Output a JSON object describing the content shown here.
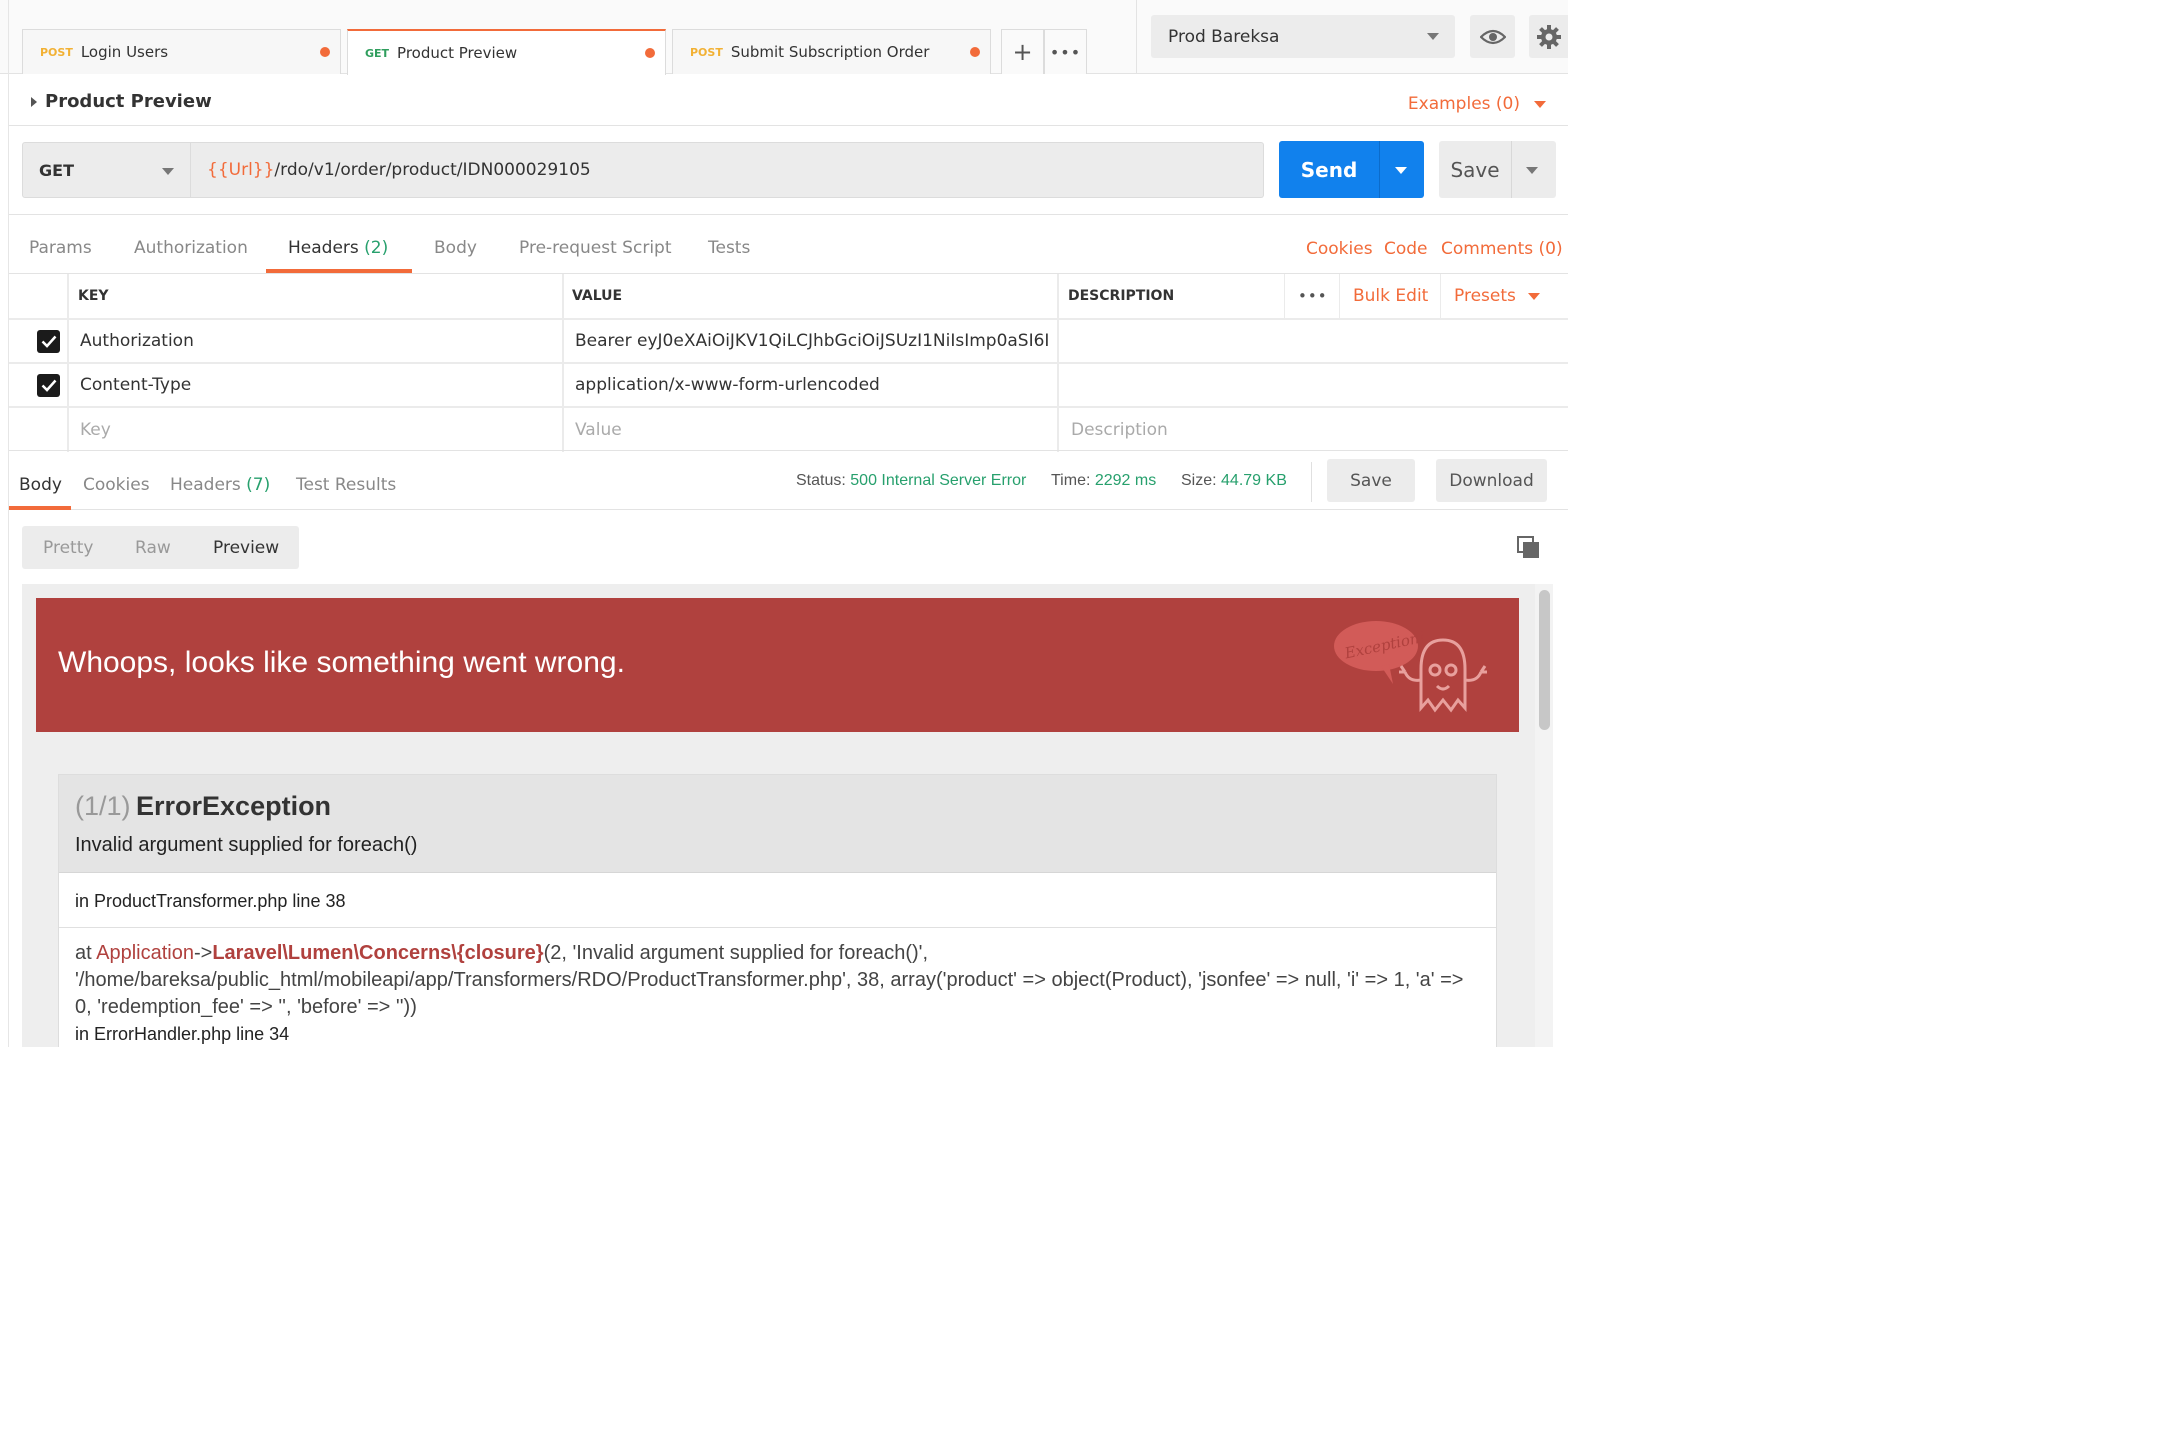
{
  "tabs": [
    {
      "method": "POST",
      "name": "Login Users"
    },
    {
      "method": "GET",
      "name": "Product Preview"
    },
    {
      "method": "POST",
      "name": "Submit Subscription Order"
    }
  ],
  "tab_actions": {
    "new_tab": "+",
    "more": "•••"
  },
  "environment": {
    "selected": "Prod Bareksa"
  },
  "request": {
    "name": "Product Preview",
    "examples_label": "Examples (0)",
    "method": "GET",
    "url_var": "{{Url}}",
    "url_path": "/rdo/v1/order/product/IDN000029105",
    "send_label": "Send",
    "save_label": "Save"
  },
  "request_tabs": {
    "params": "Params",
    "authorization": "Authorization",
    "headers": "Headers",
    "headers_count": "(2)",
    "body": "Body",
    "prerequest": "Pre-request Script",
    "tests": "Tests",
    "cookies": "Cookies",
    "code": "Code",
    "comments": "Comments (0)"
  },
  "headers_table": {
    "col_key": "KEY",
    "col_value": "VALUE",
    "col_description": "DESCRIPTION",
    "more": "•••",
    "bulk_edit": "Bulk Edit",
    "presets": "Presets",
    "rows": [
      {
        "key": "Authorization",
        "value": "Bearer eyJ0eXAiOiJKV1QiLCJhbGciOiJSUzI1NiIsImp0aSI6I..."
      },
      {
        "key": "Content-Type",
        "value": "application/x-www-form-urlencoded"
      }
    ],
    "placeholder": {
      "key": "Key",
      "value": "Value",
      "description": "Description"
    }
  },
  "response": {
    "tabs": {
      "body": "Body",
      "cookies": "Cookies",
      "headers": "Headers",
      "headers_count": "(7)",
      "test_results": "Test Results"
    },
    "status_label": "Status:",
    "status_value": "500 Internal Server Error",
    "time_label": "Time:",
    "time_value": "2292 ms",
    "size_label": "Size:",
    "size_value": "44.79 KB",
    "save_label": "Save",
    "download_label": "Download",
    "view_modes": {
      "pretty": "Pretty",
      "raw": "Raw",
      "preview": "Preview"
    }
  },
  "error_page": {
    "banner": "Whoops, looks like something went wrong.",
    "badge_text": "Exception!",
    "index": "(1/1)",
    "exception_class": "ErrorException",
    "message": "Invalid argument supplied for foreach()",
    "location": "in ProductTransformer.php line 38",
    "trace_at": "at",
    "trace_class": "Application",
    "trace_arrow": "->",
    "trace_fn": "Laravel\\Lumen\\Concerns\\{closure}",
    "trace_args": "(2, 'Invalid argument supplied for foreach()', '/home/bareksa/public_html/mobileapi/app/Transformers/RDO/ProductTransformer.php', 38, array('product' => object(Product), 'jsonfee' => null, 'i' => 1, 'a' => 0, 'redemption_fee' => '', 'before' => ''))",
    "trace_location": "in ErrorHandler.php line 34"
  },
  "colors": {
    "accent": "#f26b3a",
    "send": "#1181ed",
    "success": "#27a06d",
    "error_banner": "#b0413e"
  }
}
